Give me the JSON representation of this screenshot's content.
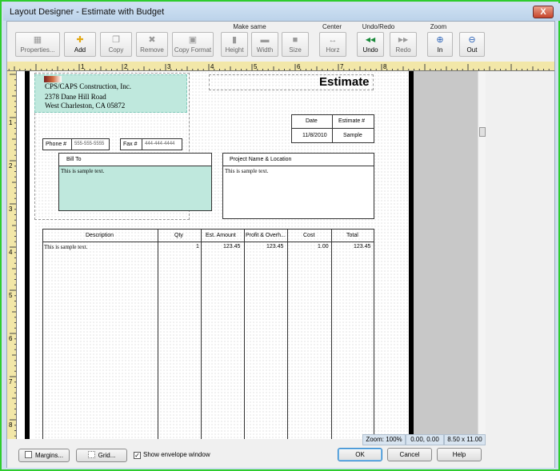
{
  "window": {
    "title": "Layout Designer - Estimate with Budget",
    "close": "X"
  },
  "toolbar": {
    "groups": {
      "make_same": "Make same",
      "center": "Center",
      "undo_redo": "Undo/Redo",
      "zoom": "Zoom"
    },
    "buttons": [
      {
        "id": "properties",
        "label": "Properties...",
        "icon": "properties-icon",
        "glyph": "▦"
      },
      {
        "id": "add",
        "label": "Add",
        "icon": "add-icon",
        "glyph": "✚"
      },
      {
        "id": "copy",
        "label": "Copy",
        "icon": "copy-icon",
        "glyph": "❐"
      },
      {
        "id": "remove",
        "label": "Remove",
        "icon": "remove-icon",
        "glyph": "✖"
      },
      {
        "id": "copy-format",
        "label": "Copy Format",
        "icon": "copy-format-icon",
        "glyph": "▣"
      },
      {
        "id": "height",
        "label": "Height",
        "icon": "height-icon",
        "glyph": "▮"
      },
      {
        "id": "width",
        "label": "Width",
        "icon": "width-icon",
        "glyph": "▬"
      },
      {
        "id": "size",
        "label": "Size",
        "icon": "size-icon",
        "glyph": "■"
      },
      {
        "id": "horz",
        "label": "Horz",
        "icon": "center-horizontal-icon",
        "glyph": "↔"
      },
      {
        "id": "undo",
        "label": "Undo",
        "icon": "undo-icon",
        "glyph": "◀◀"
      },
      {
        "id": "redo",
        "label": "Redo",
        "icon": "redo-icon",
        "glyph": "▶▶"
      },
      {
        "id": "zoom-in",
        "label": "In",
        "icon": "zoom-in-icon",
        "glyph": "⊕"
      },
      {
        "id": "zoom-out",
        "label": "Out",
        "icon": "zoom-out-icon",
        "glyph": "⊖"
      }
    ]
  },
  "rulers": {
    "h": [
      "1",
      "2",
      "3",
      "4",
      "5",
      "6",
      "7",
      "8"
    ],
    "v": [
      "1",
      "2",
      "3",
      "4",
      "5",
      "6",
      "7",
      "8"
    ]
  },
  "form": {
    "heading": "Estimate",
    "company": {
      "name": "CPS/CAPS Construction, Inc.",
      "street": "2378 Dane Hill Road",
      "city": "West Charleston, CA  05872"
    },
    "phone": {
      "label": "Phone #",
      "value": "555-555-5555"
    },
    "fax": {
      "label": "Fax #",
      "value": "444-444-4444"
    },
    "date": {
      "label": "Date",
      "value": "11/8/2010"
    },
    "estimate_no": {
      "label": "Estimate #",
      "value": "Sample"
    },
    "bill_to": {
      "label": "Bill To",
      "text": "This is sample text."
    },
    "project": {
      "label": "Project Name & Location",
      "text": "This is sample text."
    },
    "table": {
      "columns": [
        "Description",
        "Qty",
        "Est. Amount",
        "Profit & Overh...",
        "Cost",
        "Total"
      ],
      "row": [
        "This is sample text.",
        "1",
        "123.45",
        "123.45",
        "1.00",
        "123.45"
      ]
    }
  },
  "status": {
    "zoom": "Zoom: 100%",
    "coords": "0.00, 0.00",
    "size": "8.50 x 11.00"
  },
  "bottom": {
    "margins": "Margins...",
    "grid": "Grid...",
    "envelope": "Show envelope window",
    "ok": "OK",
    "cancel": "Cancel",
    "help": "Help"
  },
  "colors": {
    "accent": "#2ecc2e",
    "selection": "#bfe8dd",
    "ruler": "#f2e7a8"
  }
}
